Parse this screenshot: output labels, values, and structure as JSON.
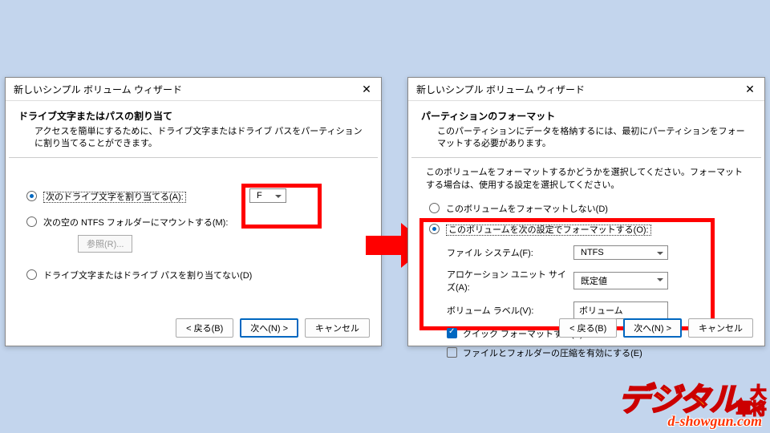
{
  "dialog_title": "新しいシンプル ボリューム ウィザード",
  "left": {
    "header_title": "ドライブ文字またはパスの割り当て",
    "header_desc": "アクセスを簡単にするために、ドライブ文字またはドライブ パスをパーティションに割り当てることができます。",
    "opt1": "次のドライブ文字を割り当てる(A):",
    "opt1_value": "F",
    "opt2": "次の空の NTFS フォルダーにマウントする(M):",
    "browse": "参照(R)...",
    "opt3": "ドライブ文字またはドライブ パスを割り当てない(D)"
  },
  "right": {
    "header_title": "パーティションのフォーマット",
    "header_desc": "このパーティションにデータを格納するには、最初にパーティションをフォーマットする必要があります。",
    "instruction": "このボリュームをフォーマットするかどうかを選択してください。フォーマットする場合は、使用する設定を選択してください。",
    "opt1": "このボリュームをフォーマットしない(D)",
    "opt2": "このボリュームを次の設定でフォーマットする(O):",
    "fs_label": "ファイル システム(F):",
    "fs_value": "NTFS",
    "au_label": "アロケーション ユニット サイズ(A):",
    "au_value": "既定値",
    "vol_label": "ボリューム ラベル(V):",
    "vol_value": "ボリューム",
    "quick": "クイック フォーマットする(P)",
    "compress": "ファイルとフォルダーの圧縮を有効にする(E)"
  },
  "buttons": {
    "back": "< 戻る(B)",
    "next": "次へ(N) >",
    "cancel": "キャンセル"
  },
  "logo": {
    "main": "デジタル",
    "sub": "大将軍",
    "url": "d-showgun.com"
  }
}
